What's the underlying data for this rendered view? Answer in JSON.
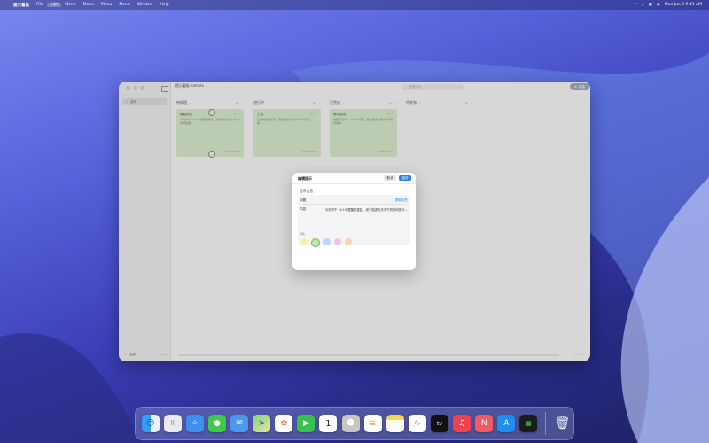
{
  "menubar": {
    "app_name": "提示看板",
    "items": [
      "File",
      "Edit",
      "Menu",
      "Menu",
      "Menu",
      "Menu",
      "Window",
      "Help"
    ],
    "selected_index": 1,
    "clock": "Mon Jun 9  9:41 AM"
  },
  "window": {
    "title": "提示看板 sample",
    "search_placeholder": "搜索提示",
    "new_button": "新建",
    "sidebar_search": "搜索",
    "sidebar_footer": "全部"
  },
  "columns": [
    {
      "label": "待处理",
      "card": {
        "title": "提取标签",
        "body": "今天中午 14:15 提醒的重复。用于描述今天中午的时间提醒……",
        "date": "2025-06-09"
      }
    },
    {
      "label": "进行中",
      "card": {
        "title": "上线",
        "body": "上线前检查事项，用于描述今天中午的时间提醒……",
        "date": "2025-06-09"
      }
    },
    {
      "label": "已完成",
      "card": {
        "title": "需求整理",
        "body": "整理今天中午 14:15 提醒。用于描述今天中午的时间提醒……",
        "date": "2025-06-09"
      }
    },
    {
      "label": "待发布",
      "card": null
    }
  ],
  "dialog": {
    "title": "编辑提示",
    "cancel": "取消",
    "save": "保存",
    "section": "提示信息",
    "title_label": "标题",
    "title_value": "提取标签",
    "content_label": "内容",
    "content_value": "今天中午 14:15 提醒的重复。用于描述今天中午的时间提示…",
    "color_label": "颜色",
    "colors": [
      "#f7f3a6",
      "#b9e6a8",
      "#b8d4f7",
      "#f5c2e4",
      "#f7d2b0"
    ],
    "selected_color_index": 1
  },
  "dock": {
    "icons": [
      "finder-icon",
      "launchpad-icon",
      "safari-icon",
      "messages-icon",
      "mail-icon",
      "maps-icon",
      "photos-icon",
      "facetime-icon",
      "calendar-icon",
      "contacts-icon",
      "reminders-icon",
      "notes-icon",
      "freeform-icon",
      "tv-icon",
      "music-icon",
      "news-icon",
      "app-store-icon",
      "activity-monitor-icon"
    ],
    "calendar_day": "1",
    "tv_label": "tv"
  }
}
